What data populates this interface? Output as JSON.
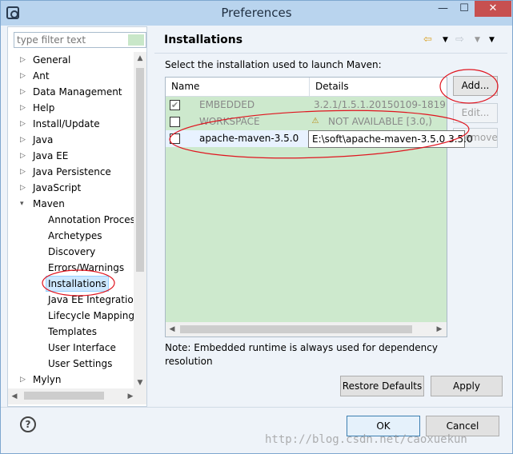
{
  "window": {
    "title": "Preferences",
    "minimize_glyph": "—",
    "maximize_glyph": "☐",
    "close_glyph": "✕"
  },
  "filter": {
    "placeholder": "type filter text"
  },
  "tree": {
    "top_items": [
      "General",
      "Ant",
      "Data Management",
      "Help",
      "Install/Update",
      "Java",
      "Java EE",
      "Java Persistence",
      "JavaScript",
      "Maven"
    ],
    "maven_children": [
      "Annotation Proces",
      "Archetypes",
      "Discovery",
      "Errors/Warnings",
      "Installations",
      "Java EE Integratio",
      "Lifecycle Mapping",
      "Templates",
      "User Interface",
      "User Settings"
    ],
    "after_items": [
      "Mylyn"
    ],
    "selected": "Installations"
  },
  "page": {
    "title": "Installations",
    "instruction": "Select the installation used to launch Maven:",
    "columns": {
      "name": "Name",
      "details": "Details"
    },
    "rows": [
      {
        "name": "EMBEDDED",
        "details": "3.2.1/1.5.1.20150109-1819",
        "checked": true,
        "enabled": false
      },
      {
        "name": "WORKSPACE",
        "details": "NOT AVAILABLE [3.0,)",
        "checked": false,
        "enabled": false,
        "warning": true
      },
      {
        "name": "apache-maven-3.5.0",
        "details": "E:\\soft\\apache-maven-3.5.0 3.5.0",
        "checked": false,
        "enabled": true
      }
    ],
    "tooltip": "E:\\soft\\apache-maven-3.5.0 3.5.0",
    "buttons": {
      "add": "Add...",
      "edit": "Edit...",
      "remove": "Remove"
    },
    "note": "Note: Embedded runtime is always used for dependency resolution",
    "restore_defaults": "Restore Defaults",
    "apply": "Apply"
  },
  "footer": {
    "help": "?",
    "ok": "OK",
    "cancel": "Cancel",
    "watermark": "http://blog.csdn.net/caoxuekun"
  },
  "colors": {
    "table_bg": "#cde9cd",
    "annotation": "#e0141e",
    "title_bar": "#b9d4ee"
  },
  "icons": {
    "nav_back": "back-arrow-icon",
    "nav_forward": "forward-arrow-icon",
    "warning": "warning-icon",
    "checkbox": "checkbox-icon"
  }
}
